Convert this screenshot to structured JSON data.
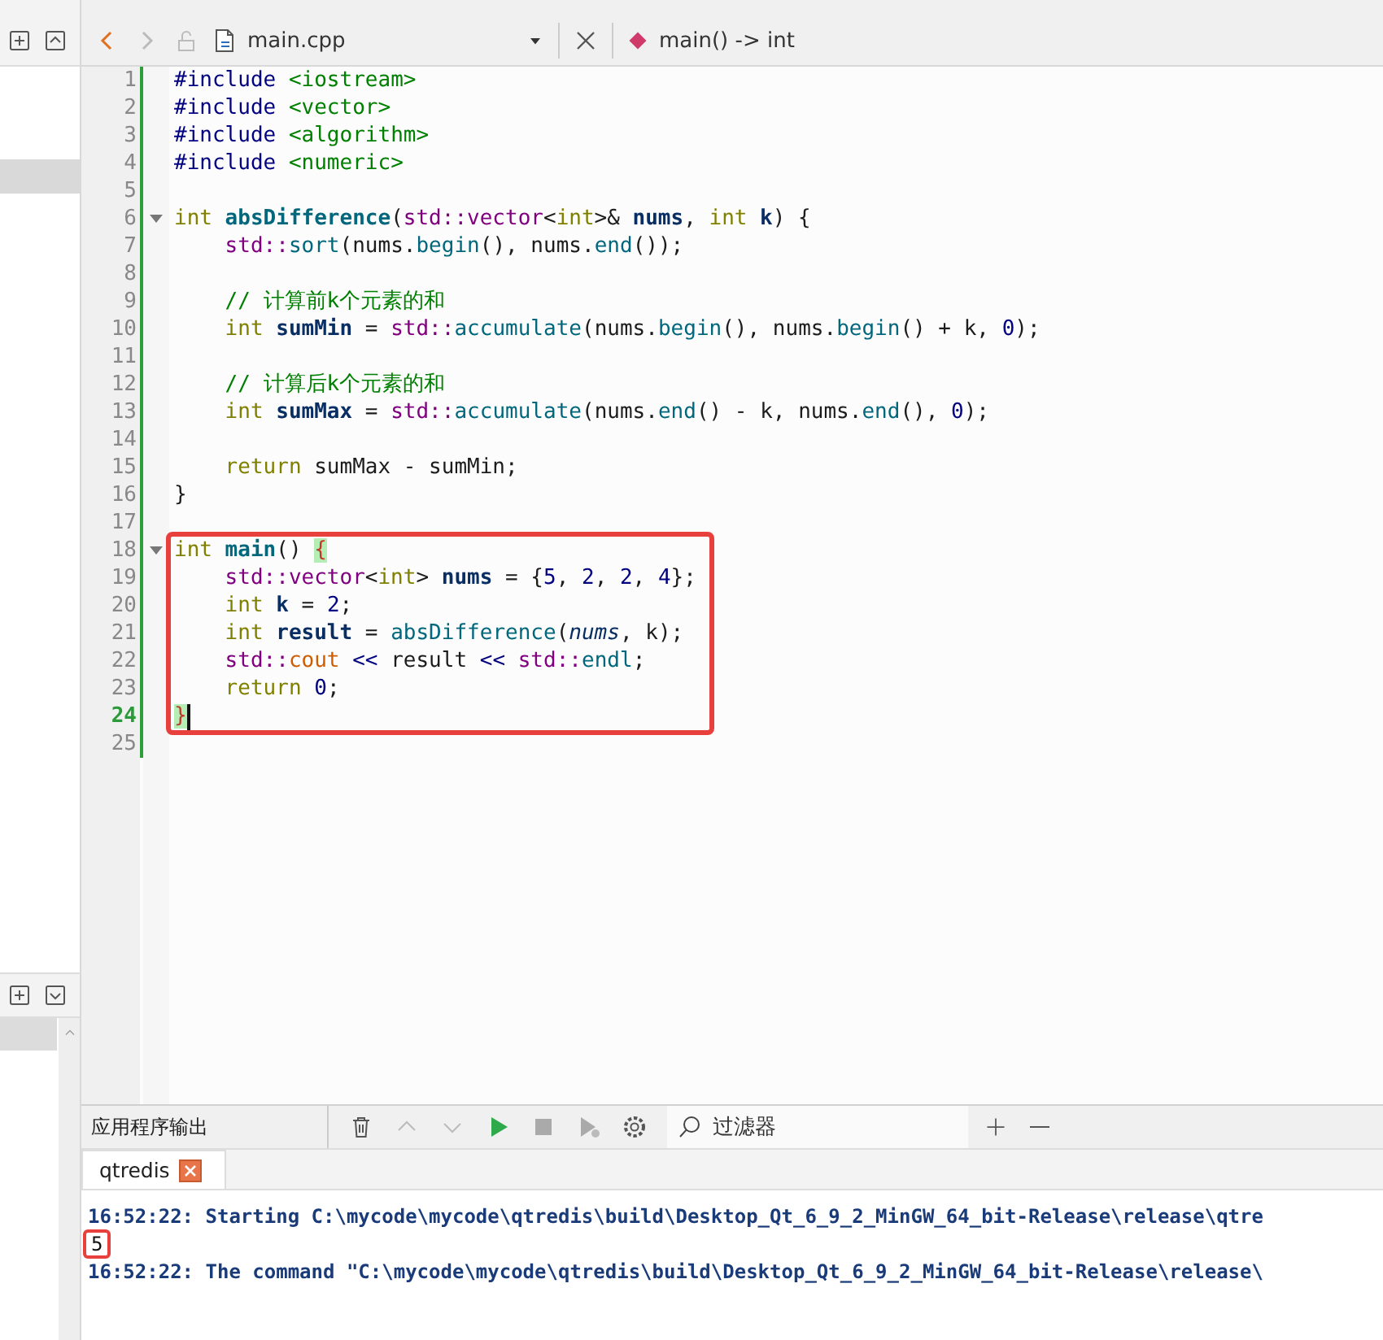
{
  "toolbar": {
    "file": "main.cpp",
    "symbol": "main() -> int"
  },
  "editor": {
    "lines": [
      {
        "number": "1",
        "tokens": [
          {
            "text": "#include",
            "kind": "pre"
          },
          {
            "text": " <iostream>",
            "kind": "inc"
          }
        ]
      },
      {
        "number": "2",
        "tokens": [
          {
            "text": "#include",
            "kind": "pre"
          },
          {
            "text": " <vector>",
            "kind": "inc"
          }
        ]
      },
      {
        "number": "3",
        "tokens": [
          {
            "text": "#include",
            "kind": "pre"
          },
          {
            "text": " <algorithm>",
            "kind": "inc"
          }
        ]
      },
      {
        "number": "4",
        "tokens": [
          {
            "text": "#include",
            "kind": "pre"
          },
          {
            "text": " <numeric>",
            "kind": "inc"
          }
        ]
      },
      {
        "number": "5"
      },
      {
        "number": "6",
        "foldable": true,
        "tokens": [
          {
            "text": "int",
            "kind": "kw"
          },
          {
            "text": " absDifference",
            "kind": "fnd"
          },
          {
            "text": "(",
            "kind": "p"
          },
          {
            "text": "std::vector",
            "kind": "ty"
          },
          {
            "text": "<",
            "kind": "p"
          },
          {
            "text": "int",
            "kind": "kw"
          },
          {
            "text": ">& ",
            "kind": "p"
          },
          {
            "text": "nums",
            "kind": "decl"
          },
          {
            "text": ", ",
            "kind": "p"
          },
          {
            "text": "int",
            "kind": "kw"
          },
          {
            "text": " k",
            "kind": "decl"
          },
          {
            "text": ") {",
            "kind": "p"
          }
        ]
      },
      {
        "number": "7",
        "tokens": [
          {
            "text": "    std::",
            "kind": "ty"
          },
          {
            "text": "sort",
            "kind": "fn"
          },
          {
            "text": "(nums.",
            "kind": "p"
          },
          {
            "text": "begin",
            "kind": "fn"
          },
          {
            "text": "(), nums.",
            "kind": "p"
          },
          {
            "text": "end",
            "kind": "fn"
          },
          {
            "text": "());",
            "kind": "p"
          }
        ]
      },
      {
        "number": "8"
      },
      {
        "number": "9",
        "tokens": [
          {
            "text": "    // 计算前k个元素的和",
            "kind": "cm"
          }
        ]
      },
      {
        "number": "10",
        "tokens": [
          {
            "text": "    int",
            "kind": "kw"
          },
          {
            "text": " sumMin",
            "kind": "decl"
          },
          {
            "text": " = ",
            "kind": "p"
          },
          {
            "text": "std::",
            "kind": "ty"
          },
          {
            "text": "accumulate",
            "kind": "fn"
          },
          {
            "text": "(nums.",
            "kind": "p"
          },
          {
            "text": "begin",
            "kind": "fn"
          },
          {
            "text": "(), nums.",
            "kind": "p"
          },
          {
            "text": "begin",
            "kind": "fn"
          },
          {
            "text": "() + k, ",
            "kind": "p"
          },
          {
            "text": "0",
            "kind": "num"
          },
          {
            "text": ");",
            "kind": "p"
          }
        ]
      },
      {
        "number": "11"
      },
      {
        "number": "12",
        "tokens": [
          {
            "text": "    // 计算后k个元素的和",
            "kind": "cm"
          }
        ]
      },
      {
        "number": "13",
        "tokens": [
          {
            "text": "    int",
            "kind": "kw"
          },
          {
            "text": " sumMax",
            "kind": "decl"
          },
          {
            "text": " = ",
            "kind": "p"
          },
          {
            "text": "std::",
            "kind": "ty"
          },
          {
            "text": "accumulate",
            "kind": "fn"
          },
          {
            "text": "(nums.",
            "kind": "p"
          },
          {
            "text": "end",
            "kind": "fn"
          },
          {
            "text": "() - k, nums.",
            "kind": "p"
          },
          {
            "text": "end",
            "kind": "fn"
          },
          {
            "text": "(), ",
            "kind": "p"
          },
          {
            "text": "0",
            "kind": "num"
          },
          {
            "text": ");",
            "kind": "p"
          }
        ]
      },
      {
        "number": "14"
      },
      {
        "number": "15",
        "tokens": [
          {
            "text": "    return",
            "kind": "kw"
          },
          {
            "text": " sumMax - sumMin;",
            "kind": "p"
          }
        ]
      },
      {
        "number": "16",
        "tokens": [
          {
            "text": "}",
            "kind": "p"
          }
        ]
      },
      {
        "number": "17"
      },
      {
        "number": "18",
        "foldable": true,
        "highlighted": true,
        "tokens": [
          {
            "text": "int",
            "kind": "kw"
          },
          {
            "text": " main",
            "kind": "fnd"
          },
          {
            "text": "() ",
            "kind": "p"
          },
          {
            "text": "{",
            "kind": "br"
          }
        ]
      },
      {
        "number": "19",
        "highlighted": true,
        "tokens": [
          {
            "text": "    std::vector",
            "kind": "ty"
          },
          {
            "text": "<",
            "kind": "p"
          },
          {
            "text": "int",
            "kind": "kw"
          },
          {
            "text": "> ",
            "kind": "p"
          },
          {
            "text": "nums",
            "kind": "decl"
          },
          {
            "text": " = {",
            "kind": "p"
          },
          {
            "text": "5",
            "kind": "num"
          },
          {
            "text": ", ",
            "kind": "p"
          },
          {
            "text": "2",
            "kind": "num"
          },
          {
            "text": ", ",
            "kind": "p"
          },
          {
            "text": "2",
            "kind": "num"
          },
          {
            "text": ", ",
            "kind": "p"
          },
          {
            "text": "4",
            "kind": "num"
          },
          {
            "text": "};",
            "kind": "p"
          }
        ]
      },
      {
        "number": "20",
        "highlighted": true,
        "tokens": [
          {
            "text": "    int",
            "kind": "kw"
          },
          {
            "text": " k",
            "kind": "decl"
          },
          {
            "text": " = ",
            "kind": "p"
          },
          {
            "text": "2",
            "kind": "num"
          },
          {
            "text": ";",
            "kind": "p"
          }
        ]
      },
      {
        "number": "21",
        "highlighted": true,
        "tokens": [
          {
            "text": "    int",
            "kind": "kw"
          },
          {
            "text": " result",
            "kind": "decl"
          },
          {
            "text": " = ",
            "kind": "p"
          },
          {
            "text": "absDifference",
            "kind": "fn"
          },
          {
            "text": "(",
            "kind": "p"
          },
          {
            "text": "nums",
            "kind": "par"
          },
          {
            "text": ", k);",
            "kind": "p"
          }
        ]
      },
      {
        "number": "22",
        "highlighted": true,
        "tokens": [
          {
            "text": "    std::",
            "kind": "ty"
          },
          {
            "text": "cout",
            "kind": "glob"
          },
          {
            "text": " <<",
            "kind": "op"
          },
          {
            "text": " result ",
            "kind": "p"
          },
          {
            "text": "<<",
            "kind": "op"
          },
          {
            "text": " std::",
            "kind": "ty"
          },
          {
            "text": "endl",
            "kind": "fn"
          },
          {
            "text": ";",
            "kind": "p"
          }
        ]
      },
      {
        "number": "23",
        "highlighted": true,
        "tokens": [
          {
            "text": "    return",
            "kind": "kw"
          },
          {
            "text": " 0",
            "kind": "num"
          },
          {
            "text": ";",
            "kind": "p"
          }
        ]
      },
      {
        "number": "24",
        "highlighted": true,
        "current": true,
        "tokens": [
          {
            "text": "}",
            "kind": "br"
          }
        ]
      },
      {
        "number": "25"
      }
    ]
  },
  "output": {
    "title": "应用程序输出",
    "filter_placeholder": "过滤器",
    "tab": "qtredis",
    "lines": [
      {
        "kind": "status",
        "text": "16:52:22: Starting C:\\mycode\\mycode\\qtredis\\build\\Desktop_Qt_6_9_2_MinGW_64_bit-Release\\release\\qtre",
        "highlighted": false
      },
      {
        "kind": "stdout",
        "text": "5",
        "highlighted": true
      },
      {
        "kind": "status",
        "text": "16:52:22: The command \"C:\\mycode\\mycode\\qtredis\\build\\Desktop_Qt_6_9_2_MinGW_64_bit-Release\\release\\",
        "highlighted": false
      }
    ]
  }
}
